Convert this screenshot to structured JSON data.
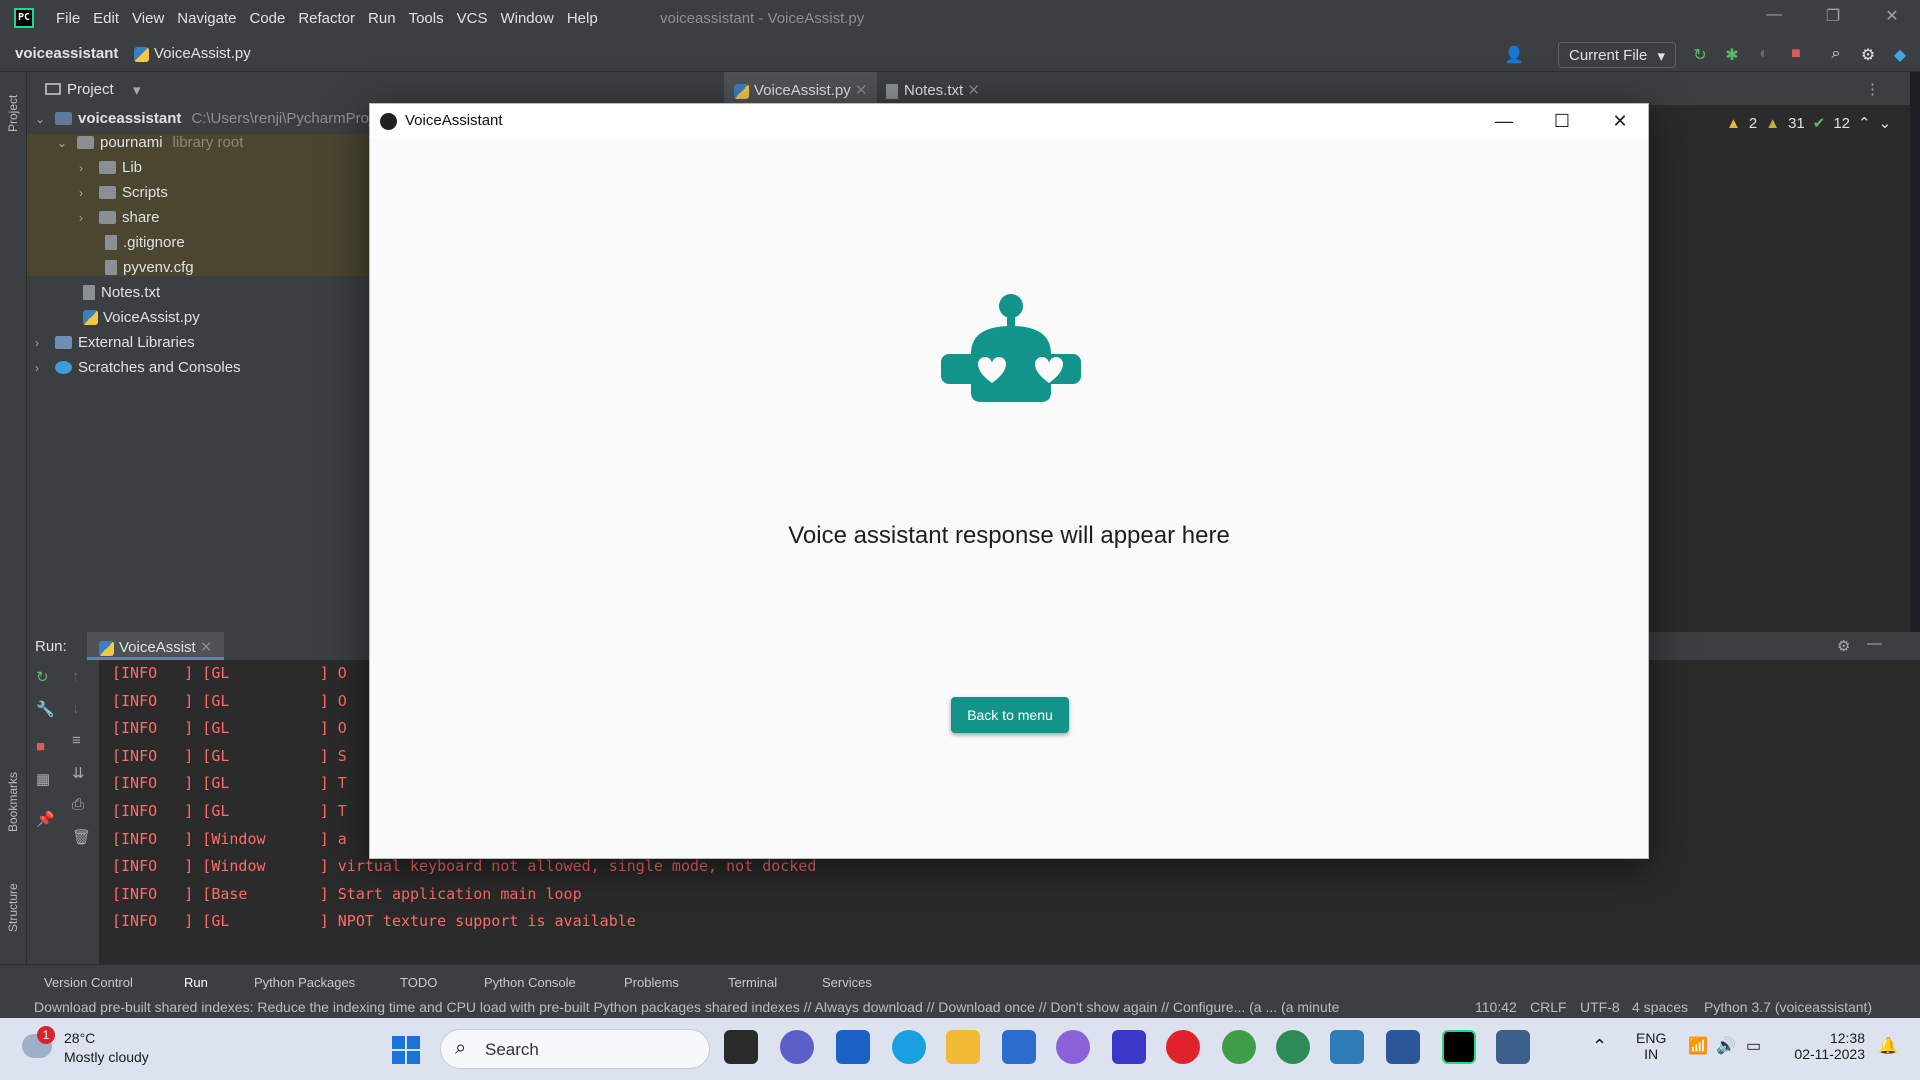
{
  "app": {
    "menu": [
      "File",
      "Edit",
      "View",
      "Navigate",
      "Code",
      "Refactor",
      "Run",
      "Tools",
      "VCS",
      "Window",
      "Help"
    ],
    "window_title": "voiceassistant - VoiceAssist.py"
  },
  "navbar": {
    "project": "voiceassistant",
    "file": "VoiceAssist.py",
    "run_config": "Current File"
  },
  "project_panel": {
    "title": "Project",
    "root": {
      "name": "voiceassistant",
      "path": "C:\\Users\\renji\\PycharmProje"
    },
    "lib": {
      "name": "pournami",
      "hint": "library root"
    },
    "lib_children": [
      "Lib",
      "Scripts",
      "share"
    ],
    "lib_files": [
      ".gitignore",
      "pyvenv.cfg"
    ],
    "root_files": [
      "Notes.txt",
      "VoiceAssist.py"
    ],
    "external": "External Libraries",
    "scratches": "Scratches and Consoles"
  },
  "editor": {
    "tabs": [
      "VoiceAssist.py",
      "Notes.txt"
    ],
    "inspections": {
      "errors": "2",
      "warnings": "31",
      "ok": "12"
    }
  },
  "run": {
    "label": "Run:",
    "tab": "VoiceAssist",
    "lines": [
      "[INFO   ] [GL          ] O",
      "[INFO   ] [GL          ] O",
      "[INFO   ] [GL          ] O",
      "[INFO   ] [GL          ] S",
      "[INFO   ] [GL          ] T",
      "[INFO   ] [GL          ] T",
      "[INFO   ] [Window      ] a",
      "[INFO   ] [Window      ] virtual keyboard not allowed, single mode, not docked",
      "[INFO   ] [Base        ] Start application main loop",
      "[INFO   ] [GL          ] NPOT texture support is available"
    ]
  },
  "side_labels": {
    "project": "Project",
    "bookmarks": "Bookmarks",
    "structure": "Structure",
    "notifications": "Notifications"
  },
  "tool_windows": [
    "Version Control",
    "Run",
    "Python Packages",
    "TODO",
    "Python Console",
    "Problems",
    "Terminal",
    "Services"
  ],
  "status": {
    "message": "Download pre-built shared indexes: Reduce the indexing time and CPU load with pre-built Python packages shared indexes // Always download // Download once // Don't show again // Configure... (a ... (a minute",
    "position": "110:42",
    "line_sep": "CRLF",
    "encoding": "UTF-8",
    "indent": "4 spaces",
    "interpreter": "Python 3.7 (voiceassistant)"
  },
  "modal": {
    "title": "VoiceAssistant",
    "response": "Voice assistant response will appear here",
    "back_button": "Back to menu",
    "accent": "#12948a"
  },
  "taskbar": {
    "weather_temp": "28°C",
    "weather_cond": "Mostly cloudy",
    "weather_badge": "1",
    "search_placeholder": "Search",
    "lang": "ENG",
    "region": "IN",
    "time": "12:38",
    "date": "02-11-2023"
  }
}
